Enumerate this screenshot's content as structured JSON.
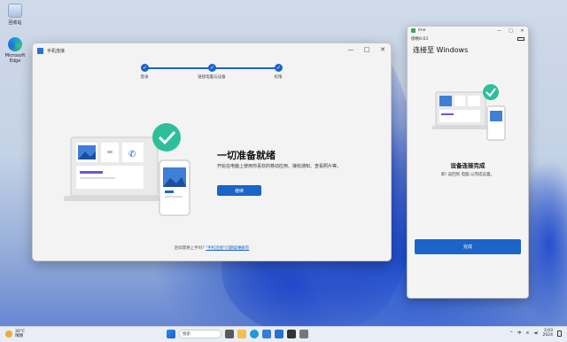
{
  "desktop": {
    "icons": [
      {
        "label": "回收站",
        "icon": "recycle-bin-icon"
      },
      {
        "label": "Microsoft Edge",
        "icon": "edge-icon"
      }
    ]
  },
  "main_window": {
    "title": "手机连接",
    "controls": {
      "minimize": "—",
      "maximize": "□",
      "close": "✕"
    },
    "steps": [
      {
        "label": "登录",
        "mark": "✓"
      },
      {
        "label": "链接电脑与设备",
        "mark": "✓"
      },
      {
        "label": "权限",
        "mark": "✓"
      }
    ],
    "heading": "一切准备就绪",
    "description": "开始在电脑上使用你喜欢的移动应用、接收通知、查看照片等。",
    "continue_button": "继续",
    "footer_text": "后续需要上手吗?",
    "footer_link": "\"手机连接\"问题疑难解答"
  },
  "phone_window": {
    "title": "Ime",
    "controls": {
      "minimize": "—",
      "maximize": "□",
      "close": "✕"
    },
    "status_time": "傍晚6:03",
    "header": "连接至 Windows",
    "heading": "设备连接完成",
    "description": "耶! 返回到 电脑 以完成设置。",
    "done_button": "完成"
  },
  "taskbar": {
    "weather_temp": "30°C",
    "weather_desc": "晴朗",
    "search_placeholder": "搜索",
    "lang": "中",
    "time": "3:03",
    "date": "2024"
  },
  "colors": {
    "accent": "#1b64c8",
    "check_green": "#2dbf9a"
  }
}
